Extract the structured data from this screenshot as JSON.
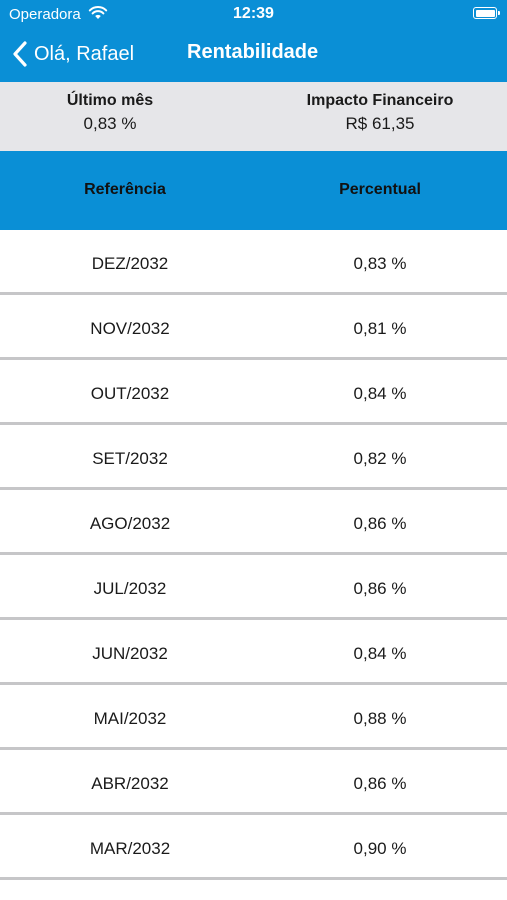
{
  "status_bar": {
    "carrier": "Operadora",
    "time": "12:39"
  },
  "nav": {
    "back_label": "Olá, Rafael",
    "title": "Rentabilidade"
  },
  "summary": {
    "last_month_label": "Último mês",
    "last_month_value": "0,83 %",
    "impact_label": "Impacto Financeiro",
    "impact_value": "R$ 61,35"
  },
  "table": {
    "headers": {
      "reference": "Referência",
      "percentual": "Percentual"
    },
    "rows": [
      {
        "reference": "DEZ/2032",
        "percentual": "0,83 %"
      },
      {
        "reference": "NOV/2032",
        "percentual": "0,81 %"
      },
      {
        "reference": "OUT/2032",
        "percentual": "0,84 %"
      },
      {
        "reference": "SET/2032",
        "percentual": "0,82 %"
      },
      {
        "reference": "AGO/2032",
        "percentual": "0,86 %"
      },
      {
        "reference": "JUL/2032",
        "percentual": "0,86 %"
      },
      {
        "reference": "JUN/2032",
        "percentual": "0,84 %"
      },
      {
        "reference": "MAI/2032",
        "percentual": "0,88 %"
      },
      {
        "reference": "ABR/2032",
        "percentual": "0,86 %"
      },
      {
        "reference": "MAR/2032",
        "percentual": "0,90 %"
      }
    ]
  },
  "colors": {
    "accent": "#0a8fd6",
    "summary_bg": "#e6e6e9",
    "row_divider": "#c6c6c8"
  },
  "icons": [
    "wifi-icon",
    "battery-icon",
    "chevron-left-icon"
  ]
}
